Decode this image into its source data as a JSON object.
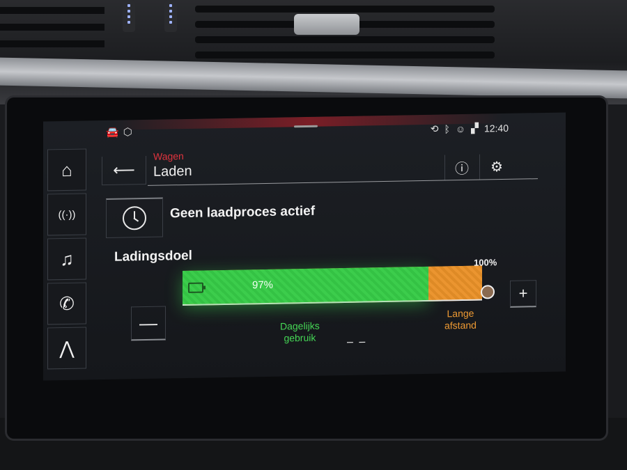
{
  "status_bar": {
    "time": "12:40",
    "icons": [
      "car-info-icon",
      "cube-icon",
      "phone-sync-icon",
      "bluetooth-icon",
      "profile-icon",
      "signal-icon"
    ]
  },
  "nav": {
    "items": [
      {
        "name": "home",
        "icon": "home-icon",
        "glyph": "⌂"
      },
      {
        "name": "radio",
        "icon": "antenna-icon",
        "glyph": "((·))"
      },
      {
        "name": "media",
        "icon": "music-note-icon",
        "glyph": "♫"
      },
      {
        "name": "phone",
        "icon": "phone-icon",
        "glyph": "✆"
      },
      {
        "name": "navigation",
        "icon": "navigation-arrow-icon",
        "glyph": "⋀"
      }
    ]
  },
  "header": {
    "breadcrumb": "Wagen",
    "title": "Laden",
    "back_glyph": "⟵",
    "info_glyph": "ⓘ",
    "settings_glyph": "⚙"
  },
  "charging": {
    "status": "Geen laadproces actief",
    "section_title": "Ladingsdoel",
    "target_percent": "97%",
    "target_fraction": 0.97,
    "max_percent": "100%",
    "minus_label": "—",
    "plus_label": "+",
    "daily_label_line1": "Dagelijks",
    "daily_label_line2": "gebruik",
    "long_label_line1": "Lange",
    "long_label_line2": "afstand",
    "range_value": "– –",
    "colors": {
      "daily": "#3ccd4c",
      "long_range": "#e8902e",
      "accent": "#e0343e"
    }
  }
}
